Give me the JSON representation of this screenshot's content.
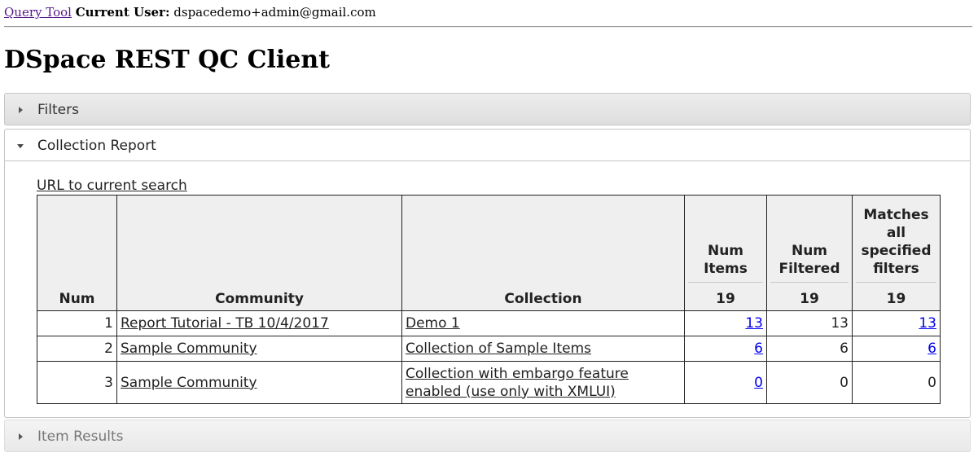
{
  "topbar": {
    "query_tool_link": "Query Tool",
    "current_user_label": "Current User:",
    "current_user_value": "dspacedemo+admin@gmail.com"
  },
  "page": {
    "title": "DSpace REST QC Client"
  },
  "accordion": {
    "filters": {
      "label": "Filters"
    },
    "collection_report": {
      "label": "Collection Report"
    },
    "item_results": {
      "label": "Item Results"
    }
  },
  "report": {
    "url_link": "URL to current search",
    "headers": {
      "num": "Num",
      "community": "Community",
      "collection": "Collection",
      "num_items": "Num Items",
      "num_filtered": "Num Filtered",
      "matches_all": "Matches all specified filters"
    },
    "totals": {
      "num_items": "19",
      "num_filtered": "19",
      "matches_all": "19"
    },
    "rows": [
      {
        "num": "1",
        "community": "Report Tutorial - TB 10/4/2017",
        "collection": "Demo 1",
        "num_items": "13",
        "num_filtered": "13",
        "matches_all": "13"
      },
      {
        "num": "2",
        "community": "Sample Community",
        "collection": "Collection of Sample Items",
        "num_items": "6",
        "num_filtered": "6",
        "matches_all": "6"
      },
      {
        "num": "3",
        "community": "Sample Community",
        "collection": "Collection with embargo feature enabled (use only with XMLUI)",
        "num_items": "0",
        "num_filtered": "0",
        "matches_all": "0"
      }
    ]
  },
  "colors": {
    "link_visited": "#551a8b",
    "link_count": "#0000ee",
    "header_bg": "#efefef"
  }
}
